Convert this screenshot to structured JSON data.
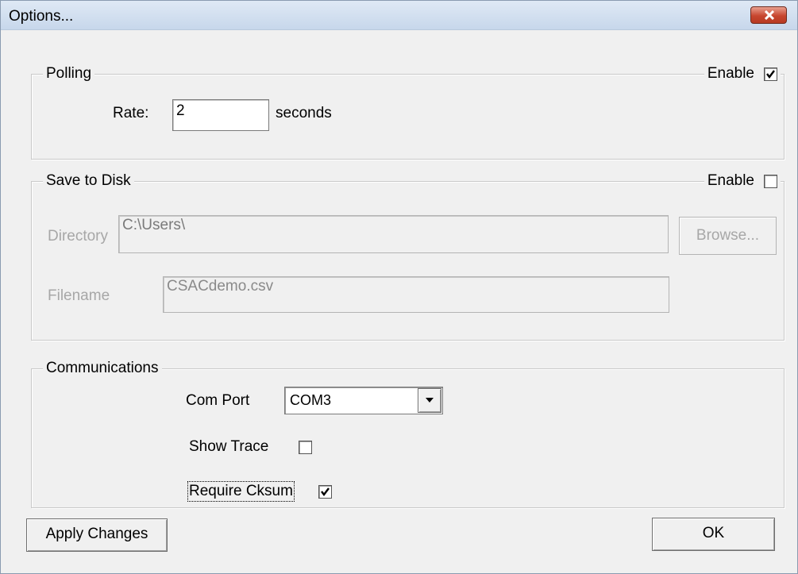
{
  "window": {
    "title": "Options..."
  },
  "polling": {
    "title": "Polling",
    "enable_label": "Enable",
    "enable_checked": true,
    "rate_label": "Rate:",
    "rate_value": "2",
    "rate_units": "seconds"
  },
  "save_to_disk": {
    "title": "Save to Disk",
    "enable_label": "Enable",
    "enable_checked": false,
    "directory_label": "Directory",
    "directory_value": "C:\\Users\\",
    "browse_label": "Browse...",
    "filename_label": "Filename",
    "filename_value": "CSACdemo.csv"
  },
  "communications": {
    "title": "Communications",
    "com_port_label": "Com Port",
    "com_port_value": "COM3",
    "show_trace_label": "Show Trace",
    "show_trace_checked": false,
    "require_cksum_label": "Require Cksum",
    "require_cksum_checked": true
  },
  "footer": {
    "apply_label": "Apply Changes",
    "ok_label": "OK"
  }
}
